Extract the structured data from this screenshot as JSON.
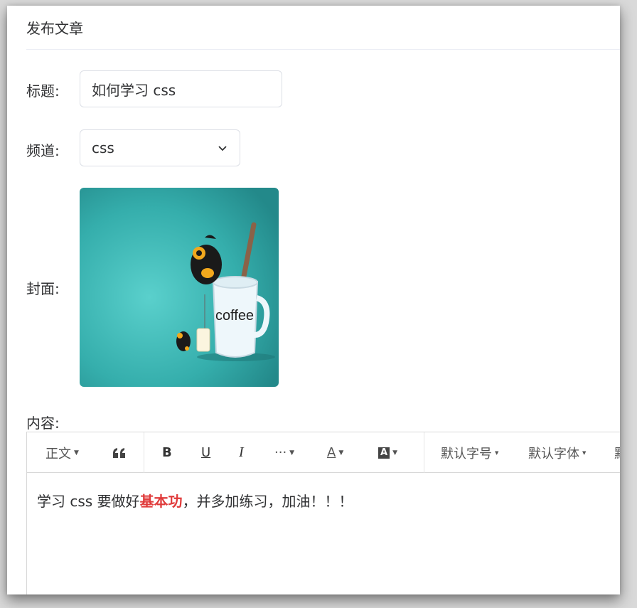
{
  "page_title": "发布文章",
  "form": {
    "title_label": "标题:",
    "title_value": "如何学习 css",
    "channel_label": "频道:",
    "channel_value": "css",
    "cover_label": "封面:",
    "cover_text": "coffee",
    "content_label": "内容:"
  },
  "toolbar": {
    "paragraph": "正文",
    "quote_icon": "quote-icon",
    "bold": "B",
    "underline": "U",
    "italic": "I",
    "more": "···",
    "font_color": "A",
    "bg_color": "A",
    "font_size": "默认字号",
    "font_family": "默认字体",
    "overflow": "默"
  },
  "content": {
    "part1": "学习 css 要做好",
    "highlight": "基本功",
    "part2": "，并多加练习，加油！！！"
  },
  "colors": {
    "highlight": "#e03b3b",
    "cover_bg": "#3bb5b3"
  }
}
